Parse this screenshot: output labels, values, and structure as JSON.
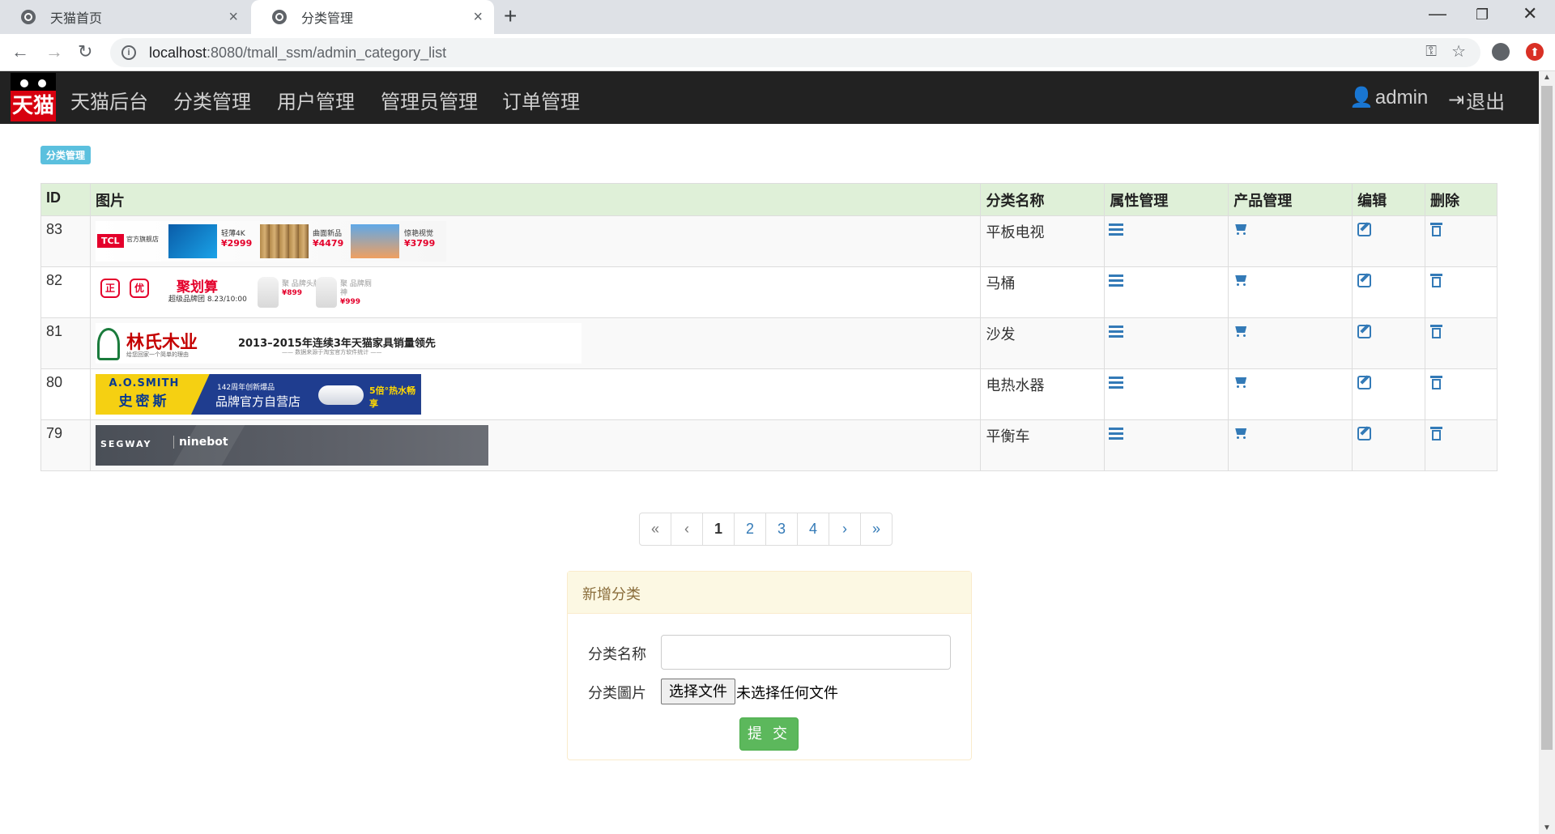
{
  "browser": {
    "tabs": [
      {
        "title": "天猫首页",
        "active": false
      },
      {
        "title": "分类管理",
        "active": true
      }
    ],
    "url_host": "localhost",
    "url_rest": ":8080/tmall_ssm/admin_category_list"
  },
  "nav": {
    "logo_text": "天猫",
    "brand": "天猫后台",
    "items": [
      "分类管理",
      "用户管理",
      "管理员管理",
      "订单管理"
    ],
    "user": "admin",
    "logout": "退出"
  },
  "page_label": "分类管理",
  "table": {
    "headers": [
      "ID",
      "图片",
      "分类名称",
      "属性管理",
      "产品管理",
      "编辑",
      "删除"
    ],
    "rows": [
      {
        "id": "83",
        "name": "平板电视"
      },
      {
        "id": "82",
        "name": "马桶"
      },
      {
        "id": "81",
        "name": "沙发"
      },
      {
        "id": "80",
        "name": "电热水器"
      },
      {
        "id": "79",
        "name": "平衡车"
      }
    ]
  },
  "banners": {
    "b1": {
      "brand": "TCL",
      "sub": "官方旗舰店",
      "t1": "轻薄4K",
      "p1": "¥2999",
      "t2": "曲面新品",
      "p2": "¥4479",
      "t3": "惊艳视觉",
      "p3": "¥3799"
    },
    "b2": {
      "seal1": "正",
      "seal2": "优",
      "title": "聚划算",
      "sub": "超级品牌团 8.23/10:00",
      "t1": "聚 品牌头牌",
      "p1": "¥899",
      "t2": "聚 品牌厕神",
      "p2": "¥999"
    },
    "b3": {
      "brand": "林氏木业",
      "brand_sub": "给您回家一个简单的理由",
      "slogan": "2013–2015年连续3年天猫家具销量领先",
      "slogan_sub": "—— 数据来源于淘宝官方软件统计 ——"
    },
    "b4": {
      "en": "A.O.SMITH",
      "cn": "史密斯",
      "t1": "142周年创新爆品",
      "t2": "品牌官方自营店",
      "t3": "5倍°热水畅享"
    },
    "b5": {
      "brand": "SEGWAY",
      "sub": "ninebot"
    }
  },
  "pagination": {
    "first": "«",
    "prev": "‹",
    "pages": [
      "1",
      "2",
      "3",
      "4"
    ],
    "current": "1",
    "next": "›",
    "last": "»"
  },
  "form": {
    "title": "新增分类",
    "name_label": "分类名称",
    "image_label": "分类圖片",
    "file_button": "选择文件",
    "file_status": "未选择任何文件",
    "submit": "提 交"
  }
}
